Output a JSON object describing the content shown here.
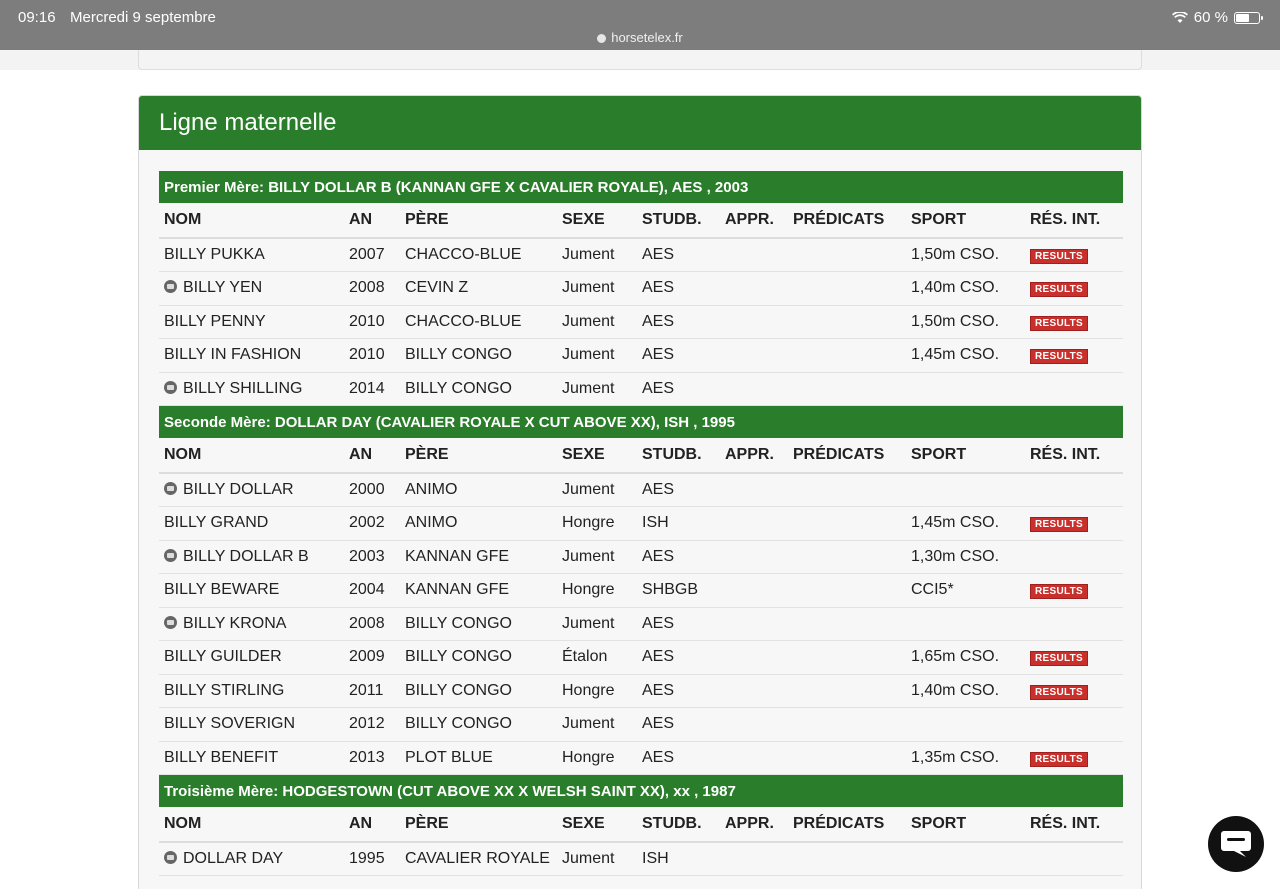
{
  "status": {
    "time": "09:16",
    "date": "Mercredi 9 septembre",
    "url": "horsetelex.fr",
    "battery": "60 %",
    "battery_level": 0.6
  },
  "panel_title": "Ligne maternelle",
  "columns": [
    "NOM",
    "AN",
    "PÈRE",
    "SEXE",
    "STUDB.",
    "APPR.",
    "PRÉDICATS",
    "SPORT",
    "RÉS. INT."
  ],
  "sections": [
    {
      "title": "Premier Mère: BILLY DOLLAR B (KANNAN GFE X CAVALIER ROYALE), AES , 2003",
      "rows": [
        {
          "name": "BILLY PUKKA",
          "icon": false,
          "year": "2007",
          "sire": "CHACCO-BLUE",
          "sex": "Jument",
          "studbook": "AES",
          "sport": "1,50m CSO.",
          "results": "RESULTS"
        },
        {
          "name": "BILLY YEN",
          "icon": true,
          "year": "2008",
          "sire": "CEVIN Z",
          "sex": "Jument",
          "studbook": "AES",
          "sport": "1,40m CSO.",
          "results": "RESULTS"
        },
        {
          "name": "BILLY PENNY",
          "icon": false,
          "year": "2010",
          "sire": "CHACCO-BLUE",
          "sex": "Jument",
          "studbook": "AES",
          "sport": "1,50m CSO.",
          "results": "RESULTS"
        },
        {
          "name": "BILLY IN FASHION",
          "icon": false,
          "year": "2010",
          "sire": "BILLY CONGO",
          "sex": "Jument",
          "studbook": "AES",
          "sport": "1,45m CSO.",
          "results": "RESULTS"
        },
        {
          "name": "BILLY SHILLING",
          "icon": true,
          "year": "2014",
          "sire": "BILLY CONGO",
          "sex": "Jument",
          "studbook": "AES",
          "sport": "",
          "results": ""
        }
      ]
    },
    {
      "title": "Seconde Mère: DOLLAR DAY (CAVALIER ROYALE X CUT ABOVE XX), ISH , 1995",
      "rows": [
        {
          "name": "BILLY DOLLAR",
          "icon": true,
          "year": "2000",
          "sire": "ANIMO",
          "sex": "Jument",
          "studbook": "AES",
          "sport": "",
          "results": ""
        },
        {
          "name": "BILLY GRAND",
          "icon": false,
          "year": "2002",
          "sire": "ANIMO",
          "sex": "Hongre",
          "studbook": "ISH",
          "sport": "1,45m CSO.",
          "results": "RESULTS"
        },
        {
          "name": "BILLY DOLLAR B",
          "icon": true,
          "year": "2003",
          "sire": "KANNAN GFE",
          "sex": "Jument",
          "studbook": "AES",
          "sport": "1,30m CSO.",
          "results": ""
        },
        {
          "name": "BILLY BEWARE",
          "icon": false,
          "year": "2004",
          "sire": "KANNAN GFE",
          "sex": "Hongre",
          "studbook": "SHBGB",
          "sport": "CCI5*",
          "results": "RESULTS"
        },
        {
          "name": "BILLY KRONA",
          "icon": true,
          "year": "2008",
          "sire": "BILLY CONGO",
          "sex": "Jument",
          "studbook": "AES",
          "sport": "",
          "results": ""
        },
        {
          "name": "BILLY GUILDER",
          "icon": false,
          "year": "2009",
          "sire": "BILLY CONGO",
          "sex": "Étalon",
          "studbook": "AES",
          "sport": "1,65m CSO.",
          "results": "RESULTS"
        },
        {
          "name": "BILLY STIRLING",
          "icon": false,
          "year": "2011",
          "sire": "BILLY CONGO",
          "sex": "Hongre",
          "studbook": "AES",
          "sport": "1,40m CSO.",
          "results": "RESULTS"
        },
        {
          "name": "BILLY SOVERIGN",
          "icon": false,
          "year": "2012",
          "sire": "BILLY CONGO",
          "sex": "Jument",
          "studbook": "AES",
          "sport": "",
          "results": ""
        },
        {
          "name": "BILLY BENEFIT",
          "icon": false,
          "year": "2013",
          "sire": "PLOT BLUE",
          "sex": "Hongre",
          "studbook": "AES",
          "sport": "1,35m CSO.",
          "results": "RESULTS"
        }
      ]
    },
    {
      "title": "Troisième Mère: HODGESTOWN (CUT ABOVE XX X WELSH SAINT XX), xx , 1987",
      "rows": [
        {
          "name": "DOLLAR DAY",
          "icon": true,
          "year": "1995",
          "sire": "CAVALIER ROYALE",
          "sex": "Jument",
          "studbook": "ISH",
          "sport": "",
          "results": ""
        }
      ]
    }
  ],
  "colors": {
    "green": "#2a7d2a",
    "results_red": "#c9302c"
  },
  "chat_icon": "chat-bubble-icon"
}
